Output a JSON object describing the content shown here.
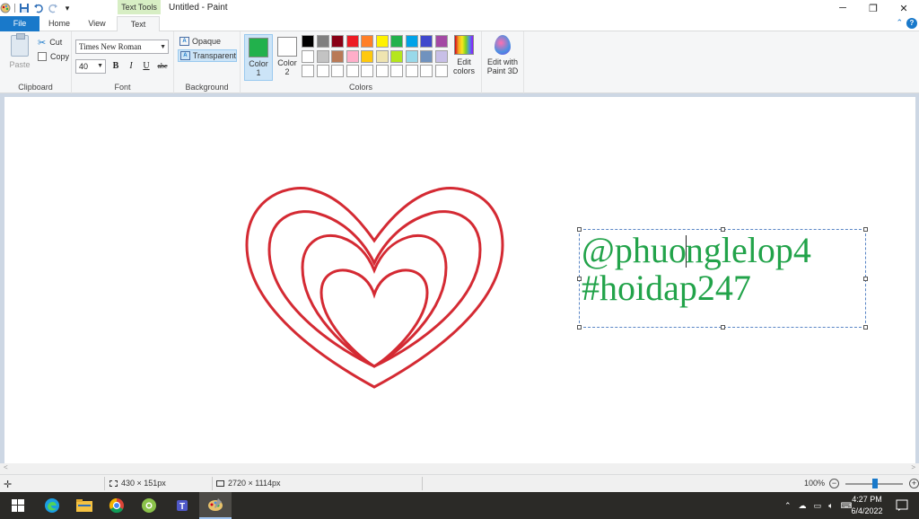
{
  "window": {
    "title": "Untitled - Paint",
    "contextual_tab_group": "Text Tools",
    "controls": {
      "minimize": "─",
      "maximize": "❐",
      "close": "✕"
    }
  },
  "tabs": {
    "file": "File",
    "home": "Home",
    "view": "View",
    "text": "Text",
    "active": "Text"
  },
  "ribbon": {
    "clipboard": {
      "paste": "Paste",
      "cut": "Cut",
      "copy": "Copy",
      "group_label": "Clipboard"
    },
    "font": {
      "family": "Times New Roman",
      "size": "40",
      "bold": "B",
      "italic": "I",
      "underline": "U",
      "strikethrough": "abc",
      "group_label": "Font"
    },
    "background": {
      "opaque": "Opaque",
      "transparent": "Transparent",
      "selected": "Transparent",
      "group_label": "Background"
    },
    "colors": {
      "color1_label": "Color",
      "color1_num": "1",
      "color1_value": "#22b14c",
      "color2_label": "Color",
      "color2_num": "2",
      "color2_value": "#ffffff",
      "group_label": "Colors",
      "palette_row1": [
        "#000000",
        "#7f7f7f",
        "#880015",
        "#ed1c24",
        "#ff7f27",
        "#fff200",
        "#22b14c",
        "#00a2e8",
        "#3f48cc",
        "#a349a4"
      ],
      "palette_row2": [
        "#ffffff",
        "#c3c3c3",
        "#b97a57",
        "#ffaec9",
        "#ffc90e",
        "#efe4b0",
        "#b5e61d",
        "#99d9ea",
        "#7092be",
        "#c8bfe7"
      ],
      "palette_row3": [
        "#ffffff",
        "#ffffff",
        "#ffffff",
        "#ffffff",
        "#ffffff",
        "#ffffff",
        "#ffffff",
        "#ffffff",
        "#ffffff",
        "#ffffff"
      ],
      "edit_colors_line1": "Edit",
      "edit_colors_line2": "colors"
    },
    "paint3d": {
      "line1": "Edit with",
      "line2": "Paint 3D"
    }
  },
  "canvas": {
    "text_line1_before_caret": "@phuo",
    "text_line1_after_caret": "nglelop4",
    "text_line2": "#hoidap247",
    "text_color": "#22a34a",
    "heart_color": "#d42a33"
  },
  "status": {
    "selection_size": "430 × 151px",
    "image_size": "2720 × 1114px",
    "zoom": "100%"
  },
  "taskbar": {
    "apps": [
      "windows-start",
      "edge",
      "file-explorer",
      "chrome",
      "chrome-alt",
      "teams",
      "paint"
    ],
    "time": "4:27 PM",
    "date": "6/4/2022"
  }
}
